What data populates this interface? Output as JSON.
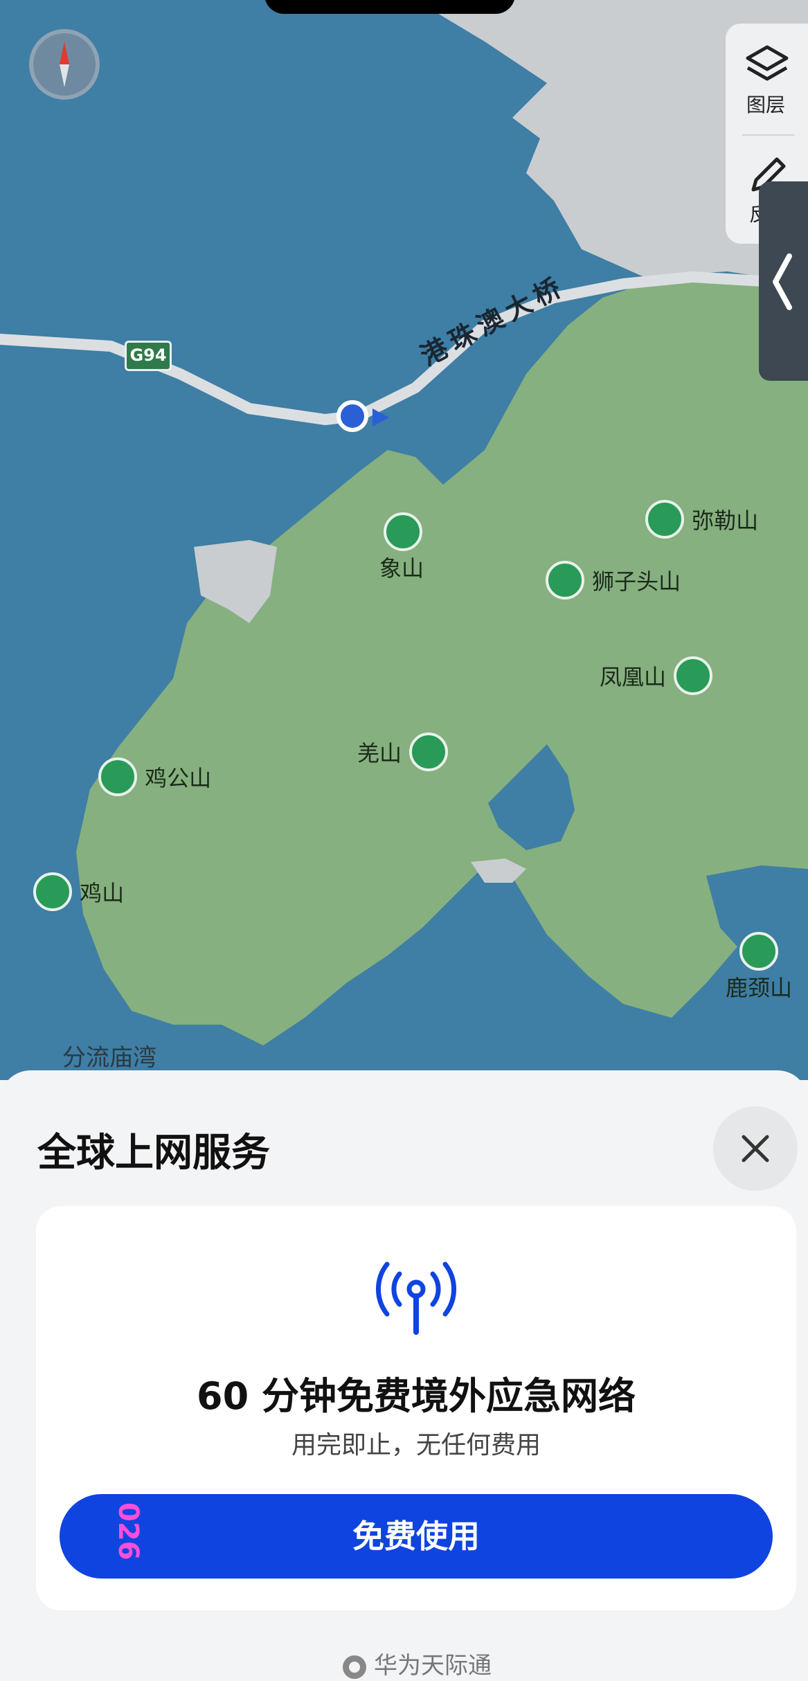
{
  "map": {
    "road_label": "港珠澳大桥",
    "highway_shield": "G94",
    "places": [
      {
        "name": "象山"
      },
      {
        "name": "弥勒山"
      },
      {
        "name": "狮子头山"
      },
      {
        "name": "凤凰山"
      },
      {
        "name": "羌山"
      },
      {
        "name": "鸡公山"
      },
      {
        "name": "鸡山"
      },
      {
        "name": "鹿颈山"
      }
    ],
    "bay_label": "分流庙湾",
    "layers_label": "图层",
    "edit_label_partial": "反",
    "compass_icon": "compass-icon",
    "colors": {
      "water": "#3f7ea5",
      "land": "#86b07f",
      "urban": "#c9cdd0",
      "road": "#dcdfe2",
      "pin": "#2a9a58",
      "location": "#2a5fd6"
    }
  },
  "sheet": {
    "title": "全球上网服务",
    "close_icon": "close-icon",
    "card": {
      "icon": "signal-tower-icon",
      "heading": "60 分钟免费境外应急网络",
      "subtext": "用完即止，无任何费用",
      "button_label": "免费使用",
      "button_overlay": "026"
    },
    "footer": "华为天际通",
    "accent": "#1044e0"
  }
}
